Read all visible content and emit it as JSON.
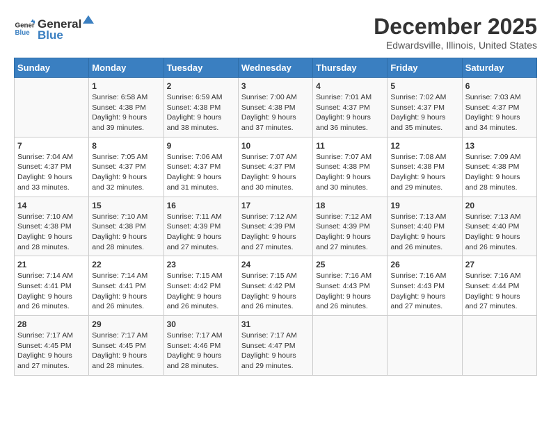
{
  "logo": {
    "general": "General",
    "blue": "Blue"
  },
  "title": "December 2025",
  "location": "Edwardsville, Illinois, United States",
  "days_of_week": [
    "Sunday",
    "Monday",
    "Tuesday",
    "Wednesday",
    "Thursday",
    "Friday",
    "Saturday"
  ],
  "weeks": [
    [
      {
        "day": "",
        "info": ""
      },
      {
        "day": "1",
        "info": "Sunrise: 6:58 AM\nSunset: 4:38 PM\nDaylight: 9 hours\nand 39 minutes."
      },
      {
        "day": "2",
        "info": "Sunrise: 6:59 AM\nSunset: 4:38 PM\nDaylight: 9 hours\nand 38 minutes."
      },
      {
        "day": "3",
        "info": "Sunrise: 7:00 AM\nSunset: 4:38 PM\nDaylight: 9 hours\nand 37 minutes."
      },
      {
        "day": "4",
        "info": "Sunrise: 7:01 AM\nSunset: 4:37 PM\nDaylight: 9 hours\nand 36 minutes."
      },
      {
        "day": "5",
        "info": "Sunrise: 7:02 AM\nSunset: 4:37 PM\nDaylight: 9 hours\nand 35 minutes."
      },
      {
        "day": "6",
        "info": "Sunrise: 7:03 AM\nSunset: 4:37 PM\nDaylight: 9 hours\nand 34 minutes."
      }
    ],
    [
      {
        "day": "7",
        "info": "Sunrise: 7:04 AM\nSunset: 4:37 PM\nDaylight: 9 hours\nand 33 minutes."
      },
      {
        "day": "8",
        "info": "Sunrise: 7:05 AM\nSunset: 4:37 PM\nDaylight: 9 hours\nand 32 minutes."
      },
      {
        "day": "9",
        "info": "Sunrise: 7:06 AM\nSunset: 4:37 PM\nDaylight: 9 hours\nand 31 minutes."
      },
      {
        "day": "10",
        "info": "Sunrise: 7:07 AM\nSunset: 4:37 PM\nDaylight: 9 hours\nand 30 minutes."
      },
      {
        "day": "11",
        "info": "Sunrise: 7:07 AM\nSunset: 4:38 PM\nDaylight: 9 hours\nand 30 minutes."
      },
      {
        "day": "12",
        "info": "Sunrise: 7:08 AM\nSunset: 4:38 PM\nDaylight: 9 hours\nand 29 minutes."
      },
      {
        "day": "13",
        "info": "Sunrise: 7:09 AM\nSunset: 4:38 PM\nDaylight: 9 hours\nand 28 minutes."
      }
    ],
    [
      {
        "day": "14",
        "info": "Sunrise: 7:10 AM\nSunset: 4:38 PM\nDaylight: 9 hours\nand 28 minutes."
      },
      {
        "day": "15",
        "info": "Sunrise: 7:10 AM\nSunset: 4:38 PM\nDaylight: 9 hours\nand 28 minutes."
      },
      {
        "day": "16",
        "info": "Sunrise: 7:11 AM\nSunset: 4:39 PM\nDaylight: 9 hours\nand 27 minutes."
      },
      {
        "day": "17",
        "info": "Sunrise: 7:12 AM\nSunset: 4:39 PM\nDaylight: 9 hours\nand 27 minutes."
      },
      {
        "day": "18",
        "info": "Sunrise: 7:12 AM\nSunset: 4:39 PM\nDaylight: 9 hours\nand 27 minutes."
      },
      {
        "day": "19",
        "info": "Sunrise: 7:13 AM\nSunset: 4:40 PM\nDaylight: 9 hours\nand 26 minutes."
      },
      {
        "day": "20",
        "info": "Sunrise: 7:13 AM\nSunset: 4:40 PM\nDaylight: 9 hours\nand 26 minutes."
      }
    ],
    [
      {
        "day": "21",
        "info": "Sunrise: 7:14 AM\nSunset: 4:41 PM\nDaylight: 9 hours\nand 26 minutes."
      },
      {
        "day": "22",
        "info": "Sunrise: 7:14 AM\nSunset: 4:41 PM\nDaylight: 9 hours\nand 26 minutes."
      },
      {
        "day": "23",
        "info": "Sunrise: 7:15 AM\nSunset: 4:42 PM\nDaylight: 9 hours\nand 26 minutes."
      },
      {
        "day": "24",
        "info": "Sunrise: 7:15 AM\nSunset: 4:42 PM\nDaylight: 9 hours\nand 26 minutes."
      },
      {
        "day": "25",
        "info": "Sunrise: 7:16 AM\nSunset: 4:43 PM\nDaylight: 9 hours\nand 26 minutes."
      },
      {
        "day": "26",
        "info": "Sunrise: 7:16 AM\nSunset: 4:43 PM\nDaylight: 9 hours\nand 27 minutes."
      },
      {
        "day": "27",
        "info": "Sunrise: 7:16 AM\nSunset: 4:44 PM\nDaylight: 9 hours\nand 27 minutes."
      }
    ],
    [
      {
        "day": "28",
        "info": "Sunrise: 7:17 AM\nSunset: 4:45 PM\nDaylight: 9 hours\nand 27 minutes."
      },
      {
        "day": "29",
        "info": "Sunrise: 7:17 AM\nSunset: 4:45 PM\nDaylight: 9 hours\nand 28 minutes."
      },
      {
        "day": "30",
        "info": "Sunrise: 7:17 AM\nSunset: 4:46 PM\nDaylight: 9 hours\nand 28 minutes."
      },
      {
        "day": "31",
        "info": "Sunrise: 7:17 AM\nSunset: 4:47 PM\nDaylight: 9 hours\nand 29 minutes."
      },
      {
        "day": "",
        "info": ""
      },
      {
        "day": "",
        "info": ""
      },
      {
        "day": "",
        "info": ""
      }
    ]
  ]
}
